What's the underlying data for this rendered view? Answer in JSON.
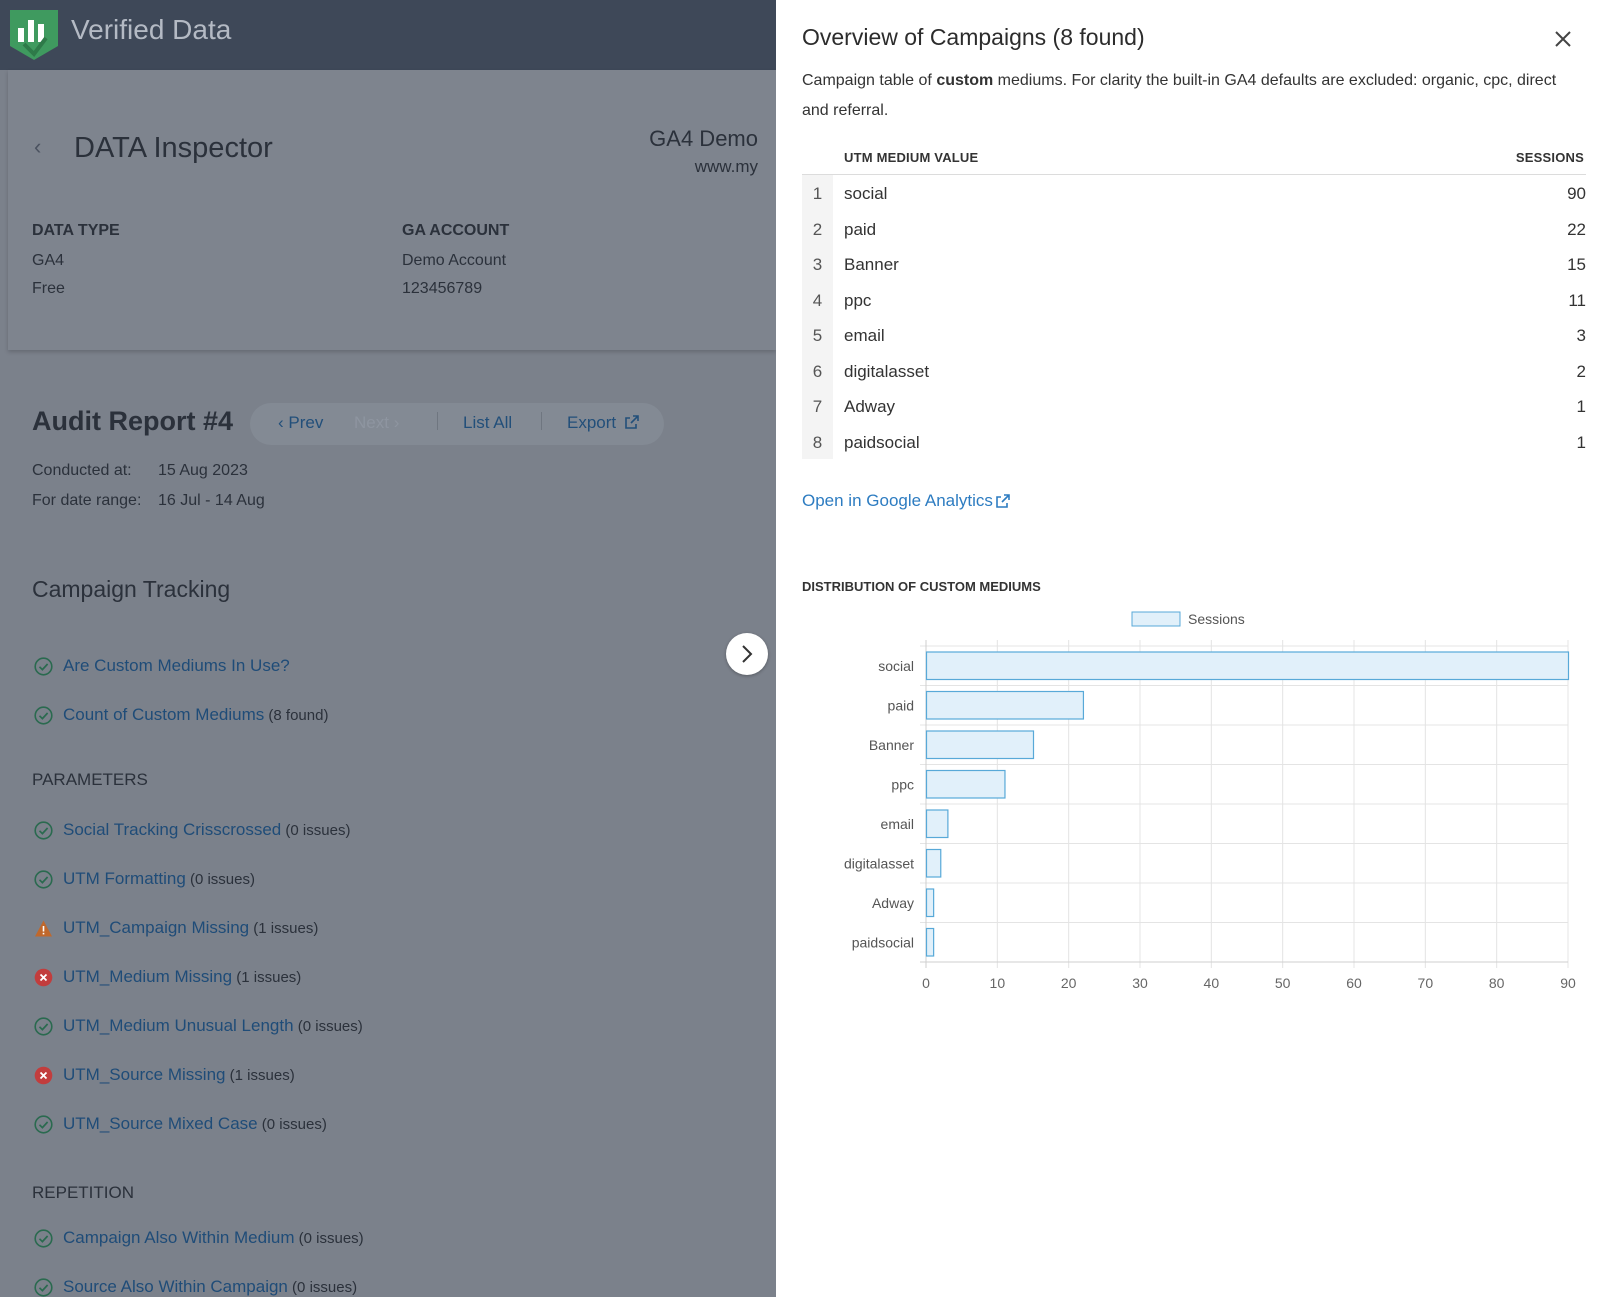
{
  "app": {
    "brand": "Verified Data"
  },
  "inspector": {
    "title": "DATA Inspector",
    "property_name": "GA4 Demo",
    "property_url": "www.my",
    "data_type_label": "DATA TYPE",
    "data_type_values": [
      "GA4",
      "Free"
    ],
    "ga_account_label": "GA ACCOUNT",
    "ga_account_values": [
      "Demo Account",
      "123456789"
    ]
  },
  "report": {
    "title": "Audit Report #4",
    "nav": {
      "prev": "Prev",
      "next": "Next",
      "list_all": "List All",
      "export": "Export"
    },
    "conducted_label": "Conducted at:",
    "conducted_value": "15 Aug 2023",
    "range_label": "For date range:",
    "range_value": "16 Jul - 14 Aug",
    "section": "Campaign Tracking",
    "checks_top": [
      {
        "label": "Are Custom Mediums In Use?",
        "count": "",
        "status": "ok"
      },
      {
        "label": "Count of Custom Mediums",
        "count": "(8 found)",
        "status": "ok"
      }
    ],
    "group_parameters": "PARAMETERS",
    "parameters": [
      {
        "label": "Social Tracking Crisscrossed",
        "count": "(0 issues)",
        "status": "ok"
      },
      {
        "label": "UTM Formatting",
        "count": "(0 issues)",
        "status": "ok"
      },
      {
        "label": "UTM_Campaign Missing",
        "count": "(1 issues)",
        "status": "warning"
      },
      {
        "label": "UTM_Medium Missing",
        "count": "(1 issues)",
        "status": "error"
      },
      {
        "label": "UTM_Medium Unusual Length",
        "count": "(0 issues)",
        "status": "ok"
      },
      {
        "label": "UTM_Source Missing",
        "count": "(1 issues)",
        "status": "error"
      },
      {
        "label": "UTM_Source Mixed Case",
        "count": "(0 issues)",
        "status": "ok"
      }
    ],
    "group_repetition": "REPETITION",
    "repetition": [
      {
        "label": "Campaign Also Within Medium",
        "count": "(0 issues)",
        "status": "ok"
      },
      {
        "label": "Source Also Within Campaign",
        "count": "(0 issues)",
        "status": "ok"
      }
    ]
  },
  "drawer": {
    "title": "Overview of Campaigns (8 found)",
    "desc_part1": "Campaign table of ",
    "desc_bold": "custom",
    "desc_part2": " mediums. For clarity the built-in GA4 defaults are excluded: organic, cpc, direct and referral.",
    "table": {
      "col_medium": "UTM MEDIUM VALUE",
      "col_sessions": "SESSIONS",
      "rows": [
        {
          "idx": "1",
          "medium": "social",
          "sessions": "90"
        },
        {
          "idx": "2",
          "medium": "paid",
          "sessions": "22"
        },
        {
          "idx": "3",
          "medium": "Banner",
          "sessions": "15"
        },
        {
          "idx": "4",
          "medium": "ppc",
          "sessions": "11"
        },
        {
          "idx": "5",
          "medium": "email",
          "sessions": "3"
        },
        {
          "idx": "6",
          "medium": "digitalasset",
          "sessions": "2"
        },
        {
          "idx": "7",
          "medium": "Adway",
          "sessions": "1"
        },
        {
          "idx": "8",
          "medium": "paidsocial",
          "sessions": "1"
        }
      ]
    },
    "ga_link": "Open in Google Analytics",
    "chart_title": "DISTRIBUTION OF CUSTOM MEDIUMS"
  },
  "colors": {
    "bar_fill": "#e1f0fa",
    "bar_stroke": "#58a9d8",
    "status_ok": "#2a6a4f",
    "status_warning": "#c0682c",
    "status_error": "#c23d3d",
    "link_dim": "#1f4c78",
    "link": "#2d7cc1"
  },
  "chart_data": {
    "type": "bar",
    "orientation": "horizontal",
    "categories": [
      "social",
      "paid",
      "Banner",
      "ppc",
      "email",
      "digitalasset",
      "Adway",
      "paidsocial"
    ],
    "series": [
      {
        "name": "Sessions",
        "values": [
          90,
          22,
          15,
          11,
          3,
          2,
          1,
          1
        ]
      }
    ],
    "xlim": [
      0,
      90
    ],
    "xticks": [
      0,
      10,
      20,
      30,
      40,
      50,
      60,
      70,
      80,
      90
    ],
    "grid": true,
    "legend": "top-center"
  }
}
